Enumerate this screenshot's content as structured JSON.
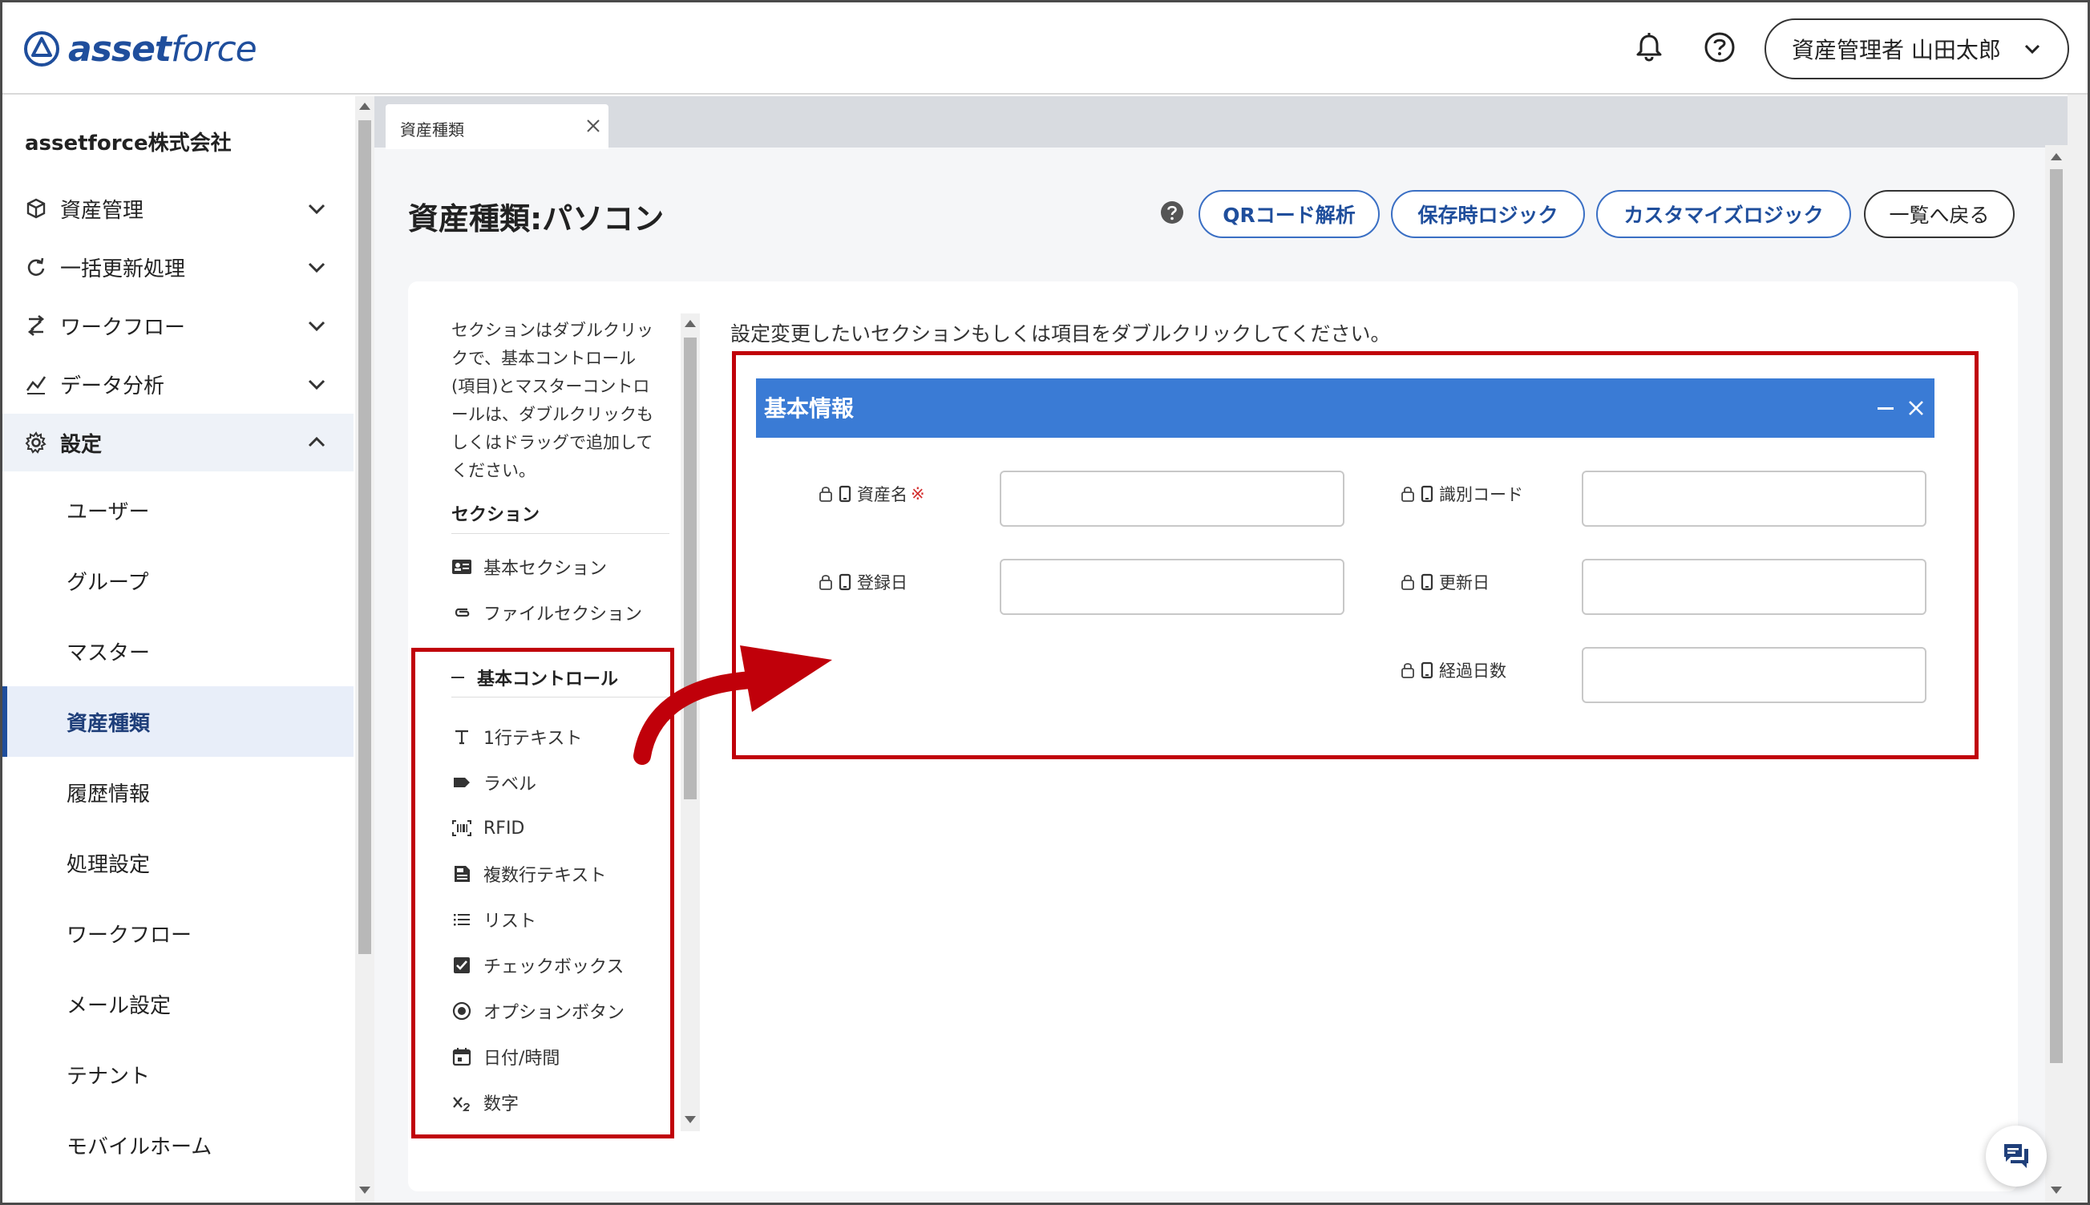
{
  "header": {
    "logo_text_bold": "asset",
    "logo_text_light": "force",
    "bell_icon": "bell-icon",
    "help_icon": "question-circle-icon",
    "user_label": "資産管理者 山田太郎"
  },
  "sidebar": {
    "company": "assetforce株式会社",
    "items": [
      {
        "label": "資産管理",
        "icon": "cube-icon",
        "expanded": false
      },
      {
        "label": "一括更新処理",
        "icon": "refresh-icon",
        "expanded": false
      },
      {
        "label": "ワークフロー",
        "icon": "workflow-icon",
        "expanded": false
      },
      {
        "label": "データ分析",
        "icon": "chart-icon",
        "expanded": false
      },
      {
        "label": "設定",
        "icon": "gear-icon",
        "expanded": true
      }
    ],
    "sub_items": [
      {
        "label": "ユーザー"
      },
      {
        "label": "グループ"
      },
      {
        "label": "マスター"
      },
      {
        "label": "資産種類",
        "active": true
      },
      {
        "label": "履歴情報"
      },
      {
        "label": "処理設定"
      },
      {
        "label": "ワークフロー"
      },
      {
        "label": "メール設定"
      },
      {
        "label": "テナント"
      },
      {
        "label": "モバイルホーム"
      }
    ]
  },
  "tabs": [
    {
      "label": "資産種類"
    }
  ],
  "page": {
    "title": "資産種類:パソコン",
    "buttons": {
      "qr": "QRコード解析",
      "save_logic": "保存時ロジック",
      "customize_logic": "カスタマイズロジック",
      "back": "一覧へ戻る"
    }
  },
  "palette": {
    "hint_lines": [
      "セクションはダブルクリッ",
      "クで、基本コントロール",
      "(項目)とマスターコントロ",
      "ールは、ダブルクリックも",
      "しくはドラッグで追加して",
      "ください。"
    ],
    "section_head": "セクション",
    "sections": [
      {
        "label": "基本セクション",
        "icon": "id-card-icon"
      },
      {
        "label": "ファイルセクション",
        "icon": "paperclip-icon"
      }
    ],
    "control_head": "基本コントロール",
    "controls": [
      {
        "label": "1行テキスト",
        "icon": "text-t-icon"
      },
      {
        "label": "ラベル",
        "icon": "tag-icon"
      },
      {
        "label": "RFID",
        "icon": "rfid-icon"
      },
      {
        "label": "複数行テキスト",
        "icon": "multiline-doc-icon"
      },
      {
        "label": "リスト",
        "icon": "list-icon"
      },
      {
        "label": "チェックボックス",
        "icon": "checkbox-icon"
      },
      {
        "label": "オプションボタン",
        "icon": "radio-icon"
      },
      {
        "label": "日付/時間",
        "icon": "calendar-icon"
      },
      {
        "label": "数字",
        "icon": "subscript-x-icon"
      }
    ]
  },
  "canvas": {
    "instruction": "設定変更したいセクションもしくは項目をダブルクリックしてください。",
    "section_title": "基本情報",
    "fields": [
      {
        "label": "資産名",
        "required_mark": "※"
      },
      {
        "label": "識別コード"
      },
      {
        "label": "登録日"
      },
      {
        "label": "更新日"
      },
      {
        "label": "経過日数"
      }
    ]
  },
  "colors": {
    "brand": "#1f4e9c",
    "section_header": "#3a7bd5",
    "highlight": "#c0000a"
  }
}
